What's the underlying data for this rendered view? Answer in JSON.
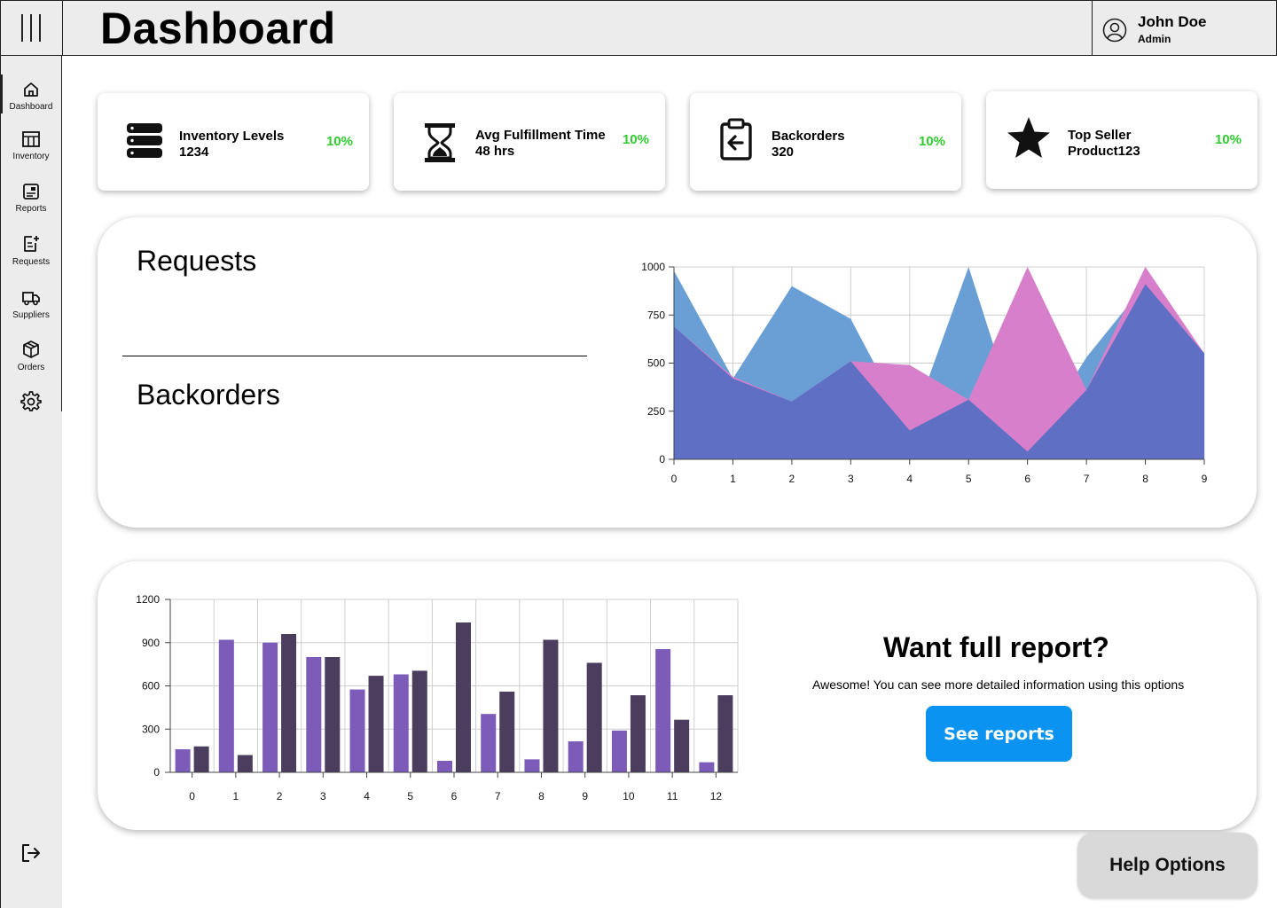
{
  "header": {
    "title": "Dashboard",
    "user": {
      "name": "John Doe",
      "role": "Admin"
    }
  },
  "sidebar": {
    "items": [
      {
        "label": "Dashboard",
        "icon": "home-icon",
        "active": true
      },
      {
        "label": "Inventory",
        "icon": "table-icon"
      },
      {
        "label": "Reports",
        "icon": "report-icon"
      },
      {
        "label": "Requests",
        "icon": "request-icon"
      },
      {
        "label": "Suppliers",
        "icon": "truck-icon"
      },
      {
        "label": "Orders",
        "icon": "box-icon"
      }
    ],
    "settings_icon": "gear-icon",
    "logout_icon": "logout-icon"
  },
  "stats": [
    {
      "title": "Inventory Levels",
      "value": "1234",
      "change": "10%",
      "icon": "database-icon"
    },
    {
      "title": "Avg Fulfillment Time",
      "value": "48 hrs",
      "change": "10%",
      "icon": "hourglass-icon"
    },
    {
      "title": "Backorders",
      "value": "320",
      "change": "10%",
      "icon": "clipboard-return-icon"
    },
    {
      "title": "Top Seller",
      "value": "Product123",
      "change": "10%",
      "icon": "star-icon"
    }
  ],
  "colors": {
    "positive": "#2ecc2e",
    "accent": "#0a93f0",
    "area_blue": "#6a9fd6",
    "area_pink": "#d77fcb",
    "area_overlap": "#5e6fc4",
    "bar_light": "#7c5cb8",
    "bar_dark": "#4a3d5e"
  },
  "panel_requests": {
    "heading_top": "Requests",
    "heading_bottom": "Backorders"
  },
  "cta": {
    "title": "Want full report?",
    "text": "Awesome! You can see more detailed information using this options",
    "button": "See reports"
  },
  "help_button": "Help Options",
  "chart_data": [
    {
      "type": "area",
      "x": [
        0,
        1,
        2,
        3,
        4,
        5,
        6,
        7,
        8,
        9
      ],
      "ylim": [
        0,
        1000
      ],
      "yticks": [
        0,
        250,
        500,
        750,
        1000
      ],
      "grid": true,
      "series": [
        {
          "values": [
            980,
            420,
            900,
            730,
            150,
            1000,
            40,
            530,
            910,
            550
          ],
          "color": "#6a9fd6"
        },
        {
          "values": [
            690,
            430,
            300,
            510,
            490,
            310,
            1000,
            360,
            1000,
            550
          ],
          "color": "#d77fcb"
        }
      ]
    },
    {
      "type": "bar",
      "categories": [
        "0",
        "1",
        "2",
        "3",
        "4",
        "5",
        "6",
        "7",
        "8",
        "9",
        "10",
        "11",
        "12"
      ],
      "ylim": [
        0,
        1200
      ],
      "yticks": [
        0,
        300,
        600,
        900,
        1200
      ],
      "grid": true,
      "series": [
        {
          "values": [
            160,
            920,
            900,
            800,
            575,
            680,
            80,
            405,
            90,
            215,
            290,
            855,
            70
          ],
          "color": "#7c5cb8"
        },
        {
          "values": [
            180,
            120,
            960,
            800,
            670,
            705,
            1040,
            560,
            920,
            760,
            535,
            365,
            535
          ],
          "color": "#4a3d5e"
        }
      ]
    }
  ]
}
